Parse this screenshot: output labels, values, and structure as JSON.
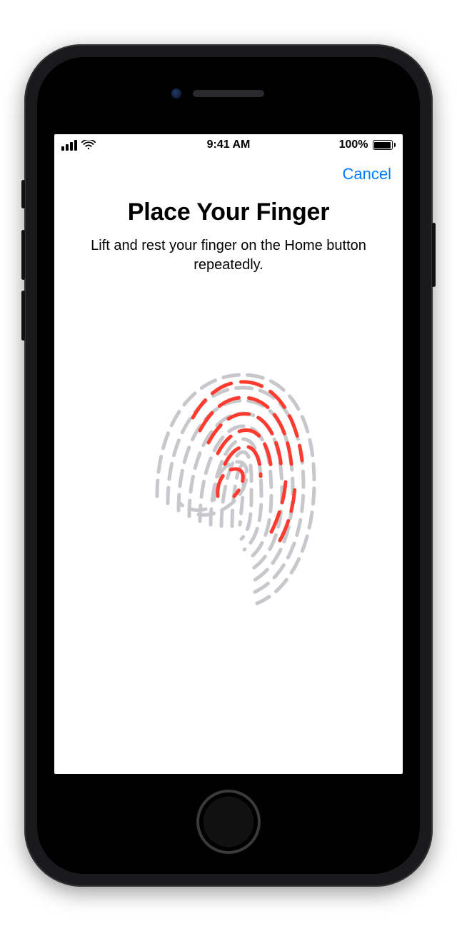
{
  "status_bar": {
    "time": "9:41 AM",
    "battery_text": "100%"
  },
  "nav": {
    "cancel_label": "Cancel"
  },
  "content": {
    "title": "Place Your Finger",
    "subtitle": "Lift and rest your finger on the Home button repeatedly."
  },
  "colors": {
    "accent": "#007aff",
    "fingerprint_highlight": "#ff3b30",
    "fingerprint_base": "#c7c7cc"
  }
}
